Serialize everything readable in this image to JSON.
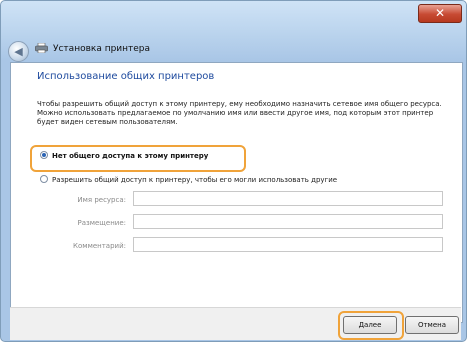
{
  "window": {
    "title": "Установка принтера",
    "close_glyph": "✕"
  },
  "content": {
    "heading": "Использование общих принтеров",
    "description": "Чтобы разрешить общий доступ к этому принтеру, ему необходимо назначить сетевое имя общего ресурса. Можно использовать предлагаемое по умолчанию имя или ввести другое имя, под которым этот принтер будет виден сетевым пользователям."
  },
  "options": {
    "no_share": {
      "label": "Нет общего доступа к этому принтеру",
      "selected": true
    },
    "share": {
      "label": "Разрешить общий доступ к принтеру, чтобы его могли использовать другие",
      "selected": false
    }
  },
  "fields": {
    "share_name": {
      "label": "Имя ресурса:",
      "value": ""
    },
    "location": {
      "label": "Размещение:",
      "value": ""
    },
    "comment": {
      "label": "Комментарий:",
      "value": ""
    }
  },
  "buttons": {
    "next": "Далее",
    "cancel": "Отмена"
  },
  "colors": {
    "heading": "#1e4a9e",
    "highlight": "#f0a33a",
    "close_button": "#c74a33"
  },
  "icons": {
    "back": "back-arrow-icon",
    "printer": "printer-icon",
    "close": "close-icon"
  }
}
